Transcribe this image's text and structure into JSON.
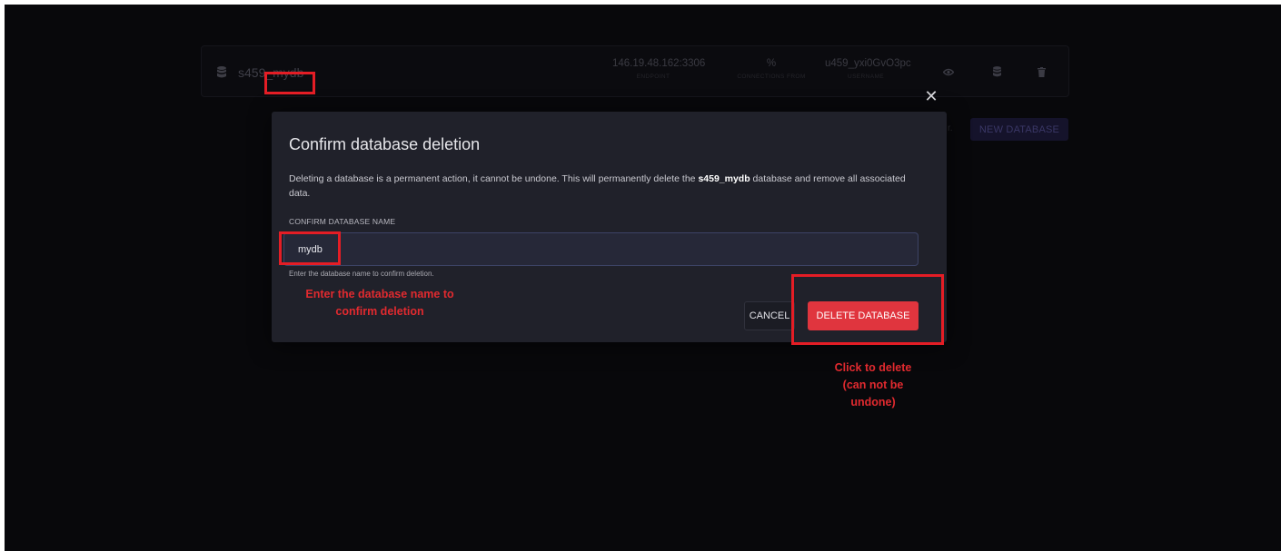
{
  "db_row": {
    "name": "s459_mydb",
    "endpoint_value": "146.19.48.162:3306",
    "endpoint_label": "ENDPOINT",
    "connections_value": "%",
    "connections_label": "CONNECTIONS FROM",
    "username_value": "u459_yxi0GvO3pc",
    "username_label": "USERNAME",
    "action_icons": [
      "eye-icon",
      "database-icon",
      "trash-icon"
    ]
  },
  "faded_text": "r.",
  "new_database_label": "NEW DATABASE",
  "modal": {
    "title": "Confirm database deletion",
    "desc_before": "Deleting a database is a permanent action, it cannot be undone. This will permanently delete the ",
    "desc_db_name": "s459_mydb",
    "desc_after": " database and remove all associated data.",
    "field_label": "CONFIRM DATABASE NAME",
    "input_value": "mydb",
    "help_text": "Enter the database name to confirm deletion.",
    "cancel_label": "CANCEL",
    "delete_label": "DELETE DATABASE",
    "close_icon": "close-icon"
  },
  "annotations": {
    "input_note": "Enter the database name to confirm deletion",
    "delete_note": "Click to delete (can not be undone)",
    "color": "#e41d25"
  }
}
